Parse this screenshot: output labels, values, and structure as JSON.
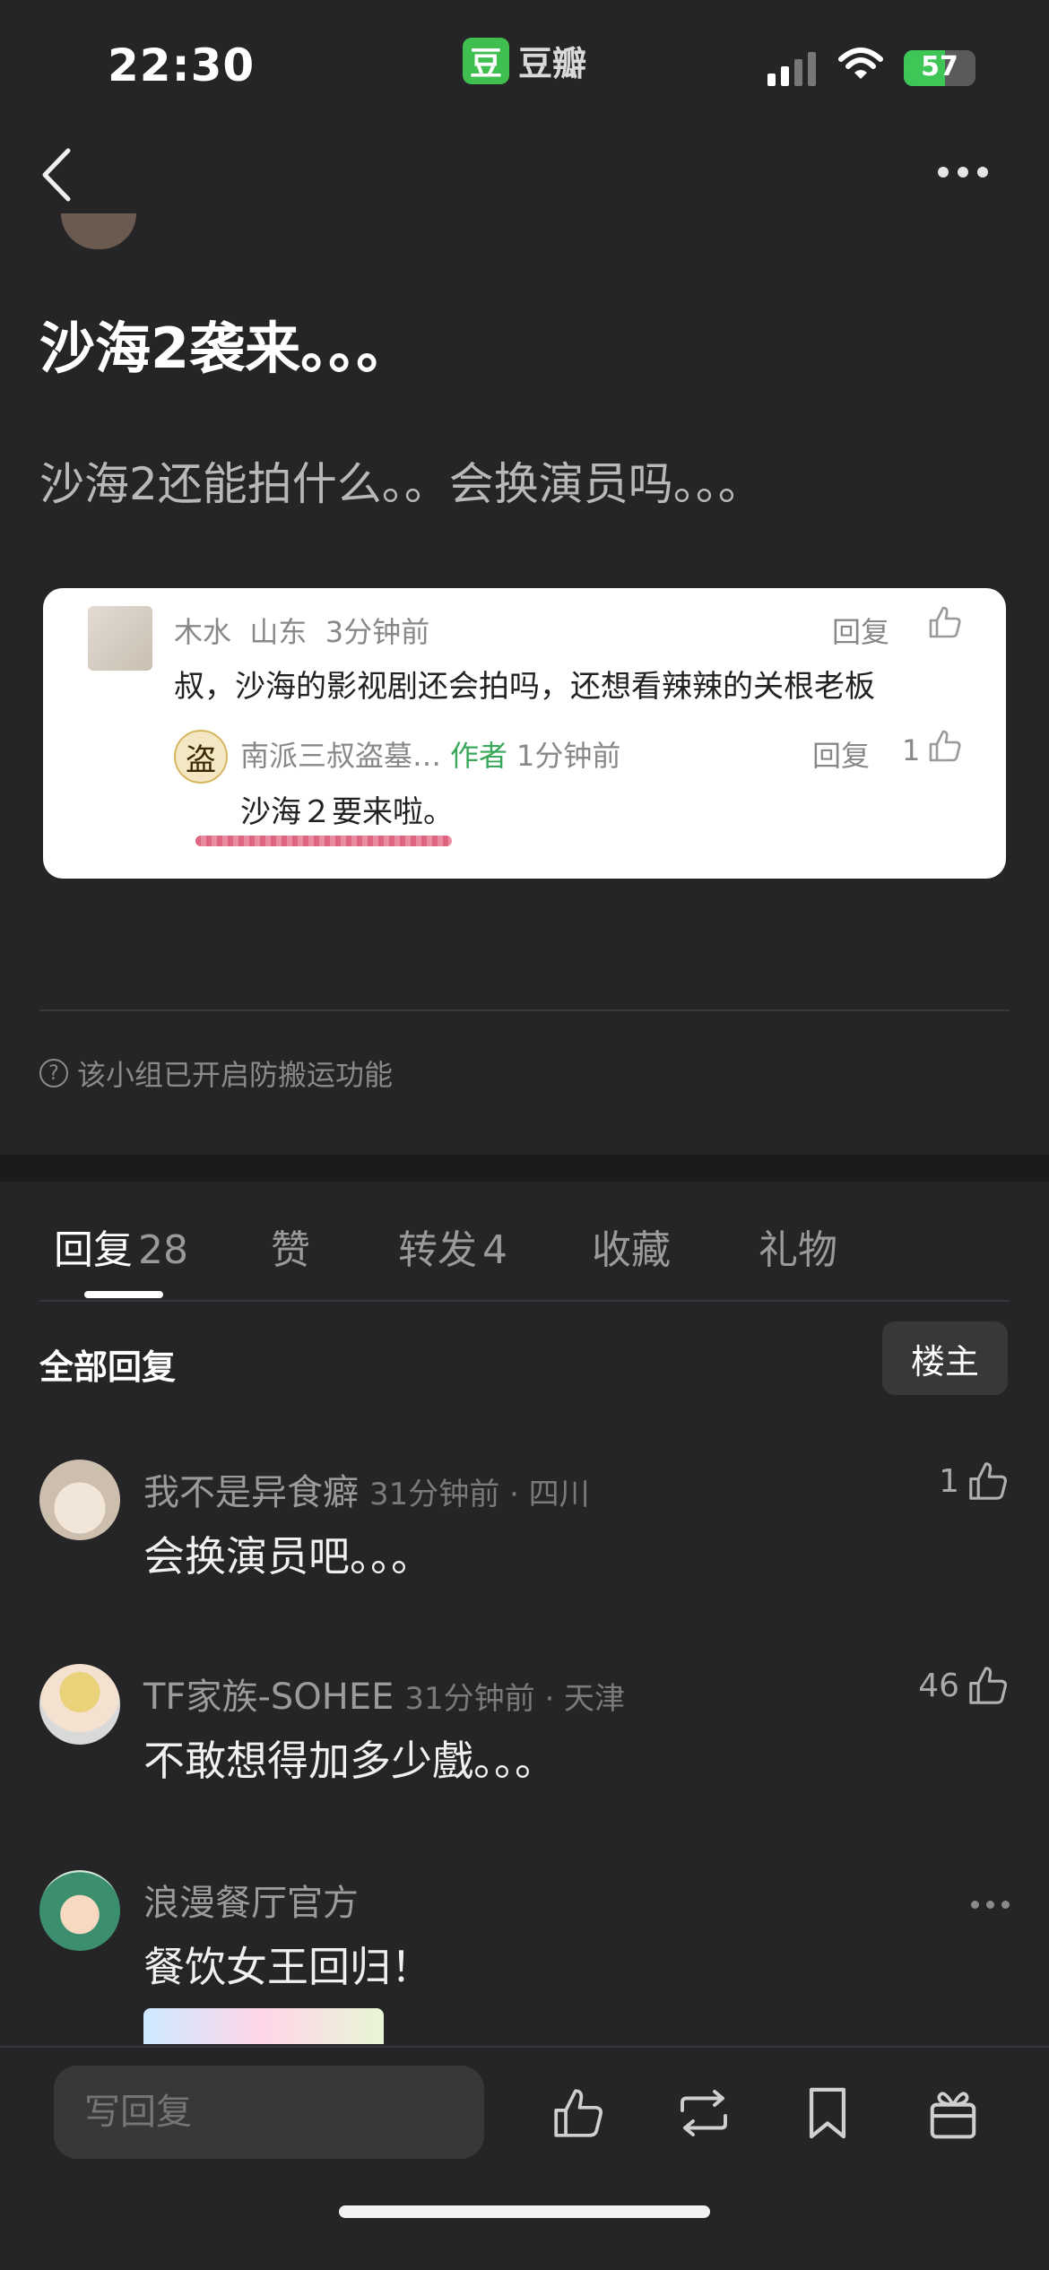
{
  "status_bar": {
    "time": "22:30",
    "app_logo": "豆",
    "app_name": "豆瓣",
    "battery": "57",
    "battery_level": 0.57
  },
  "nav": {
    "back_icon": "chevron-left-icon",
    "more_icon": "ellipsis-icon"
  },
  "post": {
    "title": "沙海2袭来。。。",
    "body": "沙海2还能拍什么。。会换演员吗。。。"
  },
  "quoted_card": {
    "comment": {
      "name": "木水",
      "location": "山东",
      "time": "3分钟前",
      "reply": "回复",
      "text": "叔，沙海的影视剧还会拍吗，还想看辣辣的关根老板"
    },
    "reply": {
      "name": "南派三叔盗墓…",
      "author_tag": "作者",
      "time": "1分钟前",
      "reply": "回复",
      "likes": "1",
      "text": "沙海２要来啦。",
      "avatar_glyph": "盗"
    }
  },
  "anti_move": "该小组已开启防搬运功能",
  "tabs": [
    {
      "label": "回复",
      "count": "28"
    },
    {
      "label": "赞",
      "count": ""
    },
    {
      "label": "转发",
      "count": "4"
    },
    {
      "label": "收藏",
      "count": ""
    },
    {
      "label": "礼物",
      "count": ""
    }
  ],
  "replies_header": {
    "title": "全部回复",
    "owner_button": "楼主"
  },
  "comments": [
    {
      "name": "我不是异食癖",
      "meta": "31分钟前 · 四川",
      "text": "会换演员吧。。。",
      "likes": "1"
    },
    {
      "name": "TF家族-SOHEE",
      "meta": "31分钟前 · 天津",
      "text": "不敢想得加多少戲。。。",
      "likes": "46"
    },
    {
      "name": "浪漫餐厅官方",
      "meta": "",
      "text": "餐饮女王回归！",
      "likes": ""
    }
  ],
  "bottom_bar": {
    "placeholder": "写回复"
  },
  "colors": {
    "background": "#252528",
    "accent_green": "#3aa85a",
    "card_bg": "#ffffff"
  }
}
